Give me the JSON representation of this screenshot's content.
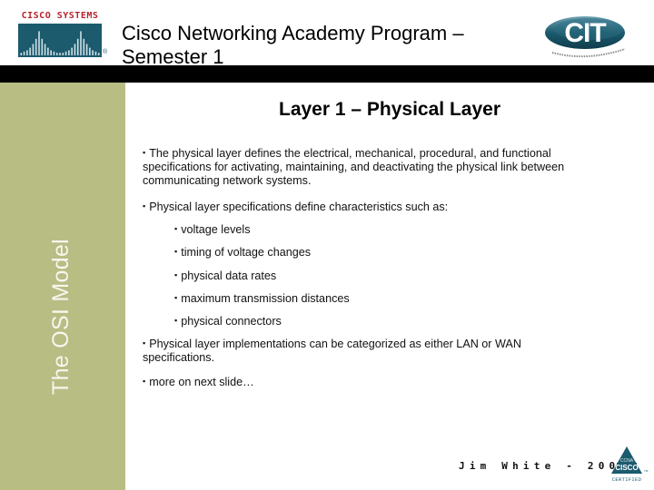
{
  "header": {
    "cisco_logo": {
      "wordmark": "CISCO SYSTEMS",
      "registered_mark": "®",
      "brand_color": "#b8232f",
      "box_color": "#1c5a6e"
    },
    "title_line1": "Cisco Networking Academy Program –",
    "title_line2": "Semester 1",
    "cit_logo": {
      "letters": "CIT",
      "color": "#1c5a6e"
    }
  },
  "sidebar": {
    "title": "The OSI Model",
    "background": "#b8bd84"
  },
  "slide": {
    "title": "Layer 1 – Physical Layer",
    "bullet_glyph": "▪",
    "bullets": [
      {
        "text": "The physical layer defines the electrical, mechanical, procedural, and functional specifications for activating, maintaining, and deactivating the physical link between communicating network systems."
      },
      {
        "text": "Physical layer specifications define characteristics such as:"
      }
    ],
    "sub_bullets": [
      {
        "text": "voltage levels"
      },
      {
        "text": "timing of voltage changes"
      },
      {
        "text": "physical data rates"
      },
      {
        "text": "maximum transmission distances"
      },
      {
        "text": "physical connectors"
      }
    ],
    "bullets_after": [
      {
        "text": "Physical layer implementations can be categorized as either LAN or WAN specifications."
      },
      {
        "text": "more on next slide…"
      }
    ]
  },
  "footer": {
    "credit": "Jim White - 2002",
    "badge": {
      "top_text": "CCNA",
      "middle_text": "CISCO",
      "bottom_text": "CERTIFIED",
      "color": "#1c5a6e"
    }
  }
}
